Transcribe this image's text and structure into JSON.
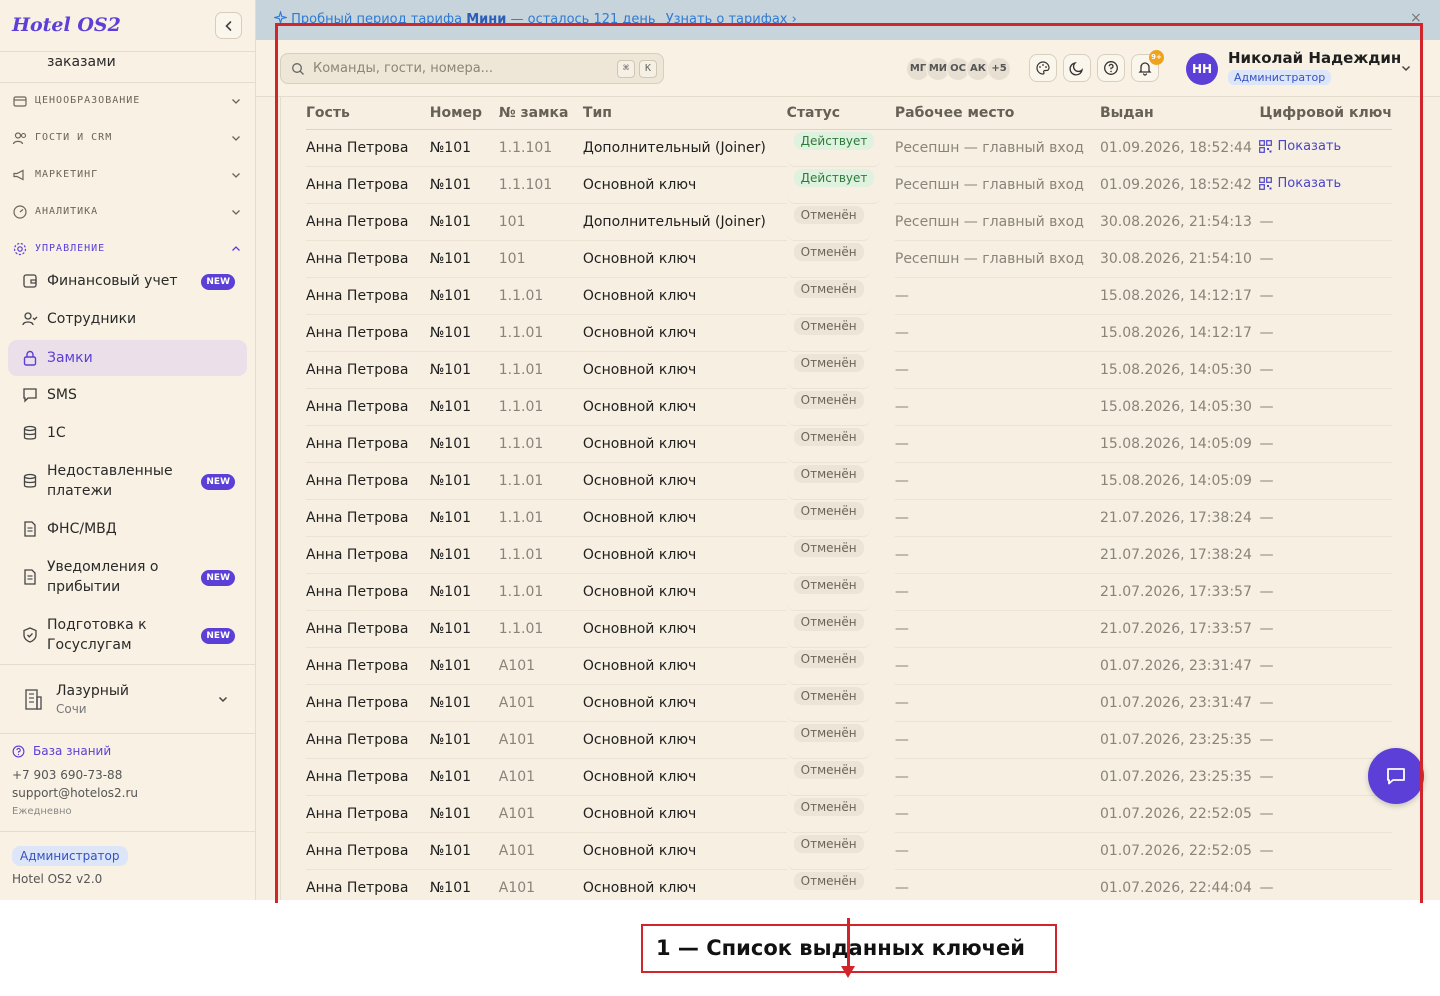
{
  "app": {
    "logo": "Hotel OS2"
  },
  "sidebar": {
    "prev_item_label": "заказами",
    "sections": [
      {
        "label": "ЦЕНООБРАЗОВАНИЕ"
      },
      {
        "label": "ГОСТИ И CRM"
      },
      {
        "label": "МАРКЕТИНГ"
      },
      {
        "label": "АНАЛИТИКА"
      },
      {
        "label": "УПРАВЛЕНИЕ"
      }
    ],
    "items": [
      {
        "label": "Финансовый учет",
        "badge": "NEW"
      },
      {
        "label": "Сотрудники"
      },
      {
        "label": "Замки"
      },
      {
        "label": "SMS"
      },
      {
        "label": "1С"
      },
      {
        "label": "Недоставленные платежи",
        "badge": "NEW"
      },
      {
        "label": "ФНС/МВД"
      },
      {
        "label": "Уведомления о прибытии",
        "badge": "NEW"
      },
      {
        "label": "Подготовка к Госуслугам",
        "badge": "NEW"
      }
    ],
    "hotel": {
      "name": "Лазурный",
      "city": "Сочи"
    },
    "knowledge_base": "База знаний",
    "phone": "+7 903 690-73-88",
    "email": "support@hotelos2.ru",
    "schedule": "Ежедневно",
    "role": "Администратор",
    "version": "Hotel OS2 v2.0"
  },
  "banner": {
    "prefix": "Пробный период тарифа",
    "plan": "Мини",
    "suffix": "— осталось 121 день",
    "link": "Узнать о тарифах ›",
    "close": "×"
  },
  "header": {
    "search_placeholder": "Команды, гости, номера...",
    "kbd1": "⌘",
    "kbd2": "K",
    "avatars": [
      "МГ",
      "МИ",
      "ОС",
      "АК",
      "+5"
    ],
    "notif_count": "9+",
    "user": {
      "initials": "НН",
      "name": "Николай Надеждин",
      "role": "Администратор"
    }
  },
  "table": {
    "columns": [
      "Гость",
      "Номер",
      "№ замка",
      "Тип",
      "Статус",
      "Рабочее место",
      "Выдан",
      "Цифровой ключ"
    ],
    "rows": [
      [
        "Анна Петрова",
        "№101",
        "1.1.101",
        "Дополнительный (Joiner)",
        "Действует",
        "Ресепшн — главный вход",
        "01.09.2026, 18:52:44",
        "Показать"
      ],
      [
        "Анна Петрова",
        "№101",
        "1.1.101",
        "Основной ключ",
        "Действует",
        "Ресепшн — главный вход",
        "01.09.2026, 18:52:42",
        "Показать"
      ],
      [
        "Анна Петрова",
        "№101",
        "101",
        "Дополнительный (Joiner)",
        "Отменён",
        "Ресепшн — главный вход",
        "30.08.2026, 21:54:13",
        "—"
      ],
      [
        "Анна Петрова",
        "№101",
        "101",
        "Основной ключ",
        "Отменён",
        "Ресепшн — главный вход",
        "30.08.2026, 21:54:10",
        "—"
      ],
      [
        "Анна Петрова",
        "№101",
        "1.1.01",
        "Основной ключ",
        "Отменён",
        "—",
        "15.08.2026, 14:12:17",
        "—"
      ],
      [
        "Анна Петрова",
        "№101",
        "1.1.01",
        "Основной ключ",
        "Отменён",
        "—",
        "15.08.2026, 14:12:17",
        "—"
      ],
      [
        "Анна Петрова",
        "№101",
        "1.1.01",
        "Основной ключ",
        "Отменён",
        "—",
        "15.08.2026, 14:05:30",
        "—"
      ],
      [
        "Анна Петрова",
        "№101",
        "1.1.01",
        "Основной ключ",
        "Отменён",
        "—",
        "15.08.2026, 14:05:30",
        "—"
      ],
      [
        "Анна Петрова",
        "№101",
        "1.1.01",
        "Основной ключ",
        "Отменён",
        "—",
        "15.08.2026, 14:05:09",
        "—"
      ],
      [
        "Анна Петрова",
        "№101",
        "1.1.01",
        "Основной ключ",
        "Отменён",
        "—",
        "15.08.2026, 14:05:09",
        "—"
      ],
      [
        "Анна Петрова",
        "№101",
        "1.1.01",
        "Основной ключ",
        "Отменён",
        "—",
        "21.07.2026, 17:38:24",
        "—"
      ],
      [
        "Анна Петрова",
        "№101",
        "1.1.01",
        "Основной ключ",
        "Отменён",
        "—",
        "21.07.2026, 17:38:24",
        "—"
      ],
      [
        "Анна Петрова",
        "№101",
        "1.1.01",
        "Основной ключ",
        "Отменён",
        "—",
        "21.07.2026, 17:33:57",
        "—"
      ],
      [
        "Анна Петрова",
        "№101",
        "1.1.01",
        "Основной ключ",
        "Отменён",
        "—",
        "21.07.2026, 17:33:57",
        "—"
      ],
      [
        "Анна Петрова",
        "№101",
        "A101",
        "Основной ключ",
        "Отменён",
        "—",
        "01.07.2026, 23:31:47",
        "—"
      ],
      [
        "Анна Петрова",
        "№101",
        "A101",
        "Основной ключ",
        "Отменён",
        "—",
        "01.07.2026, 23:31:47",
        "—"
      ],
      [
        "Анна Петрова",
        "№101",
        "A101",
        "Основной ключ",
        "Отменён",
        "—",
        "01.07.2026, 23:25:35",
        "—"
      ],
      [
        "Анна Петрова",
        "№101",
        "A101",
        "Основной ключ",
        "Отменён",
        "—",
        "01.07.2026, 23:25:35",
        "—"
      ],
      [
        "Анна Петрова",
        "№101",
        "A101",
        "Основной ключ",
        "Отменён",
        "—",
        "01.07.2026, 22:52:05",
        "—"
      ],
      [
        "Анна Петрова",
        "№101",
        "A101",
        "Основной ключ",
        "Отменён",
        "—",
        "01.07.2026, 22:52:05",
        "—"
      ],
      [
        "Анна Петрова",
        "№101",
        "A101",
        "Основной ключ",
        "Отменён",
        "—",
        "01.07.2026, 22:44:04",
        "—"
      ]
    ]
  },
  "annotation": {
    "callout": "1 — Список выданных ключей"
  },
  "colors": {
    "accent": "#5b3fd6",
    "annotation": "#d0262b"
  }
}
